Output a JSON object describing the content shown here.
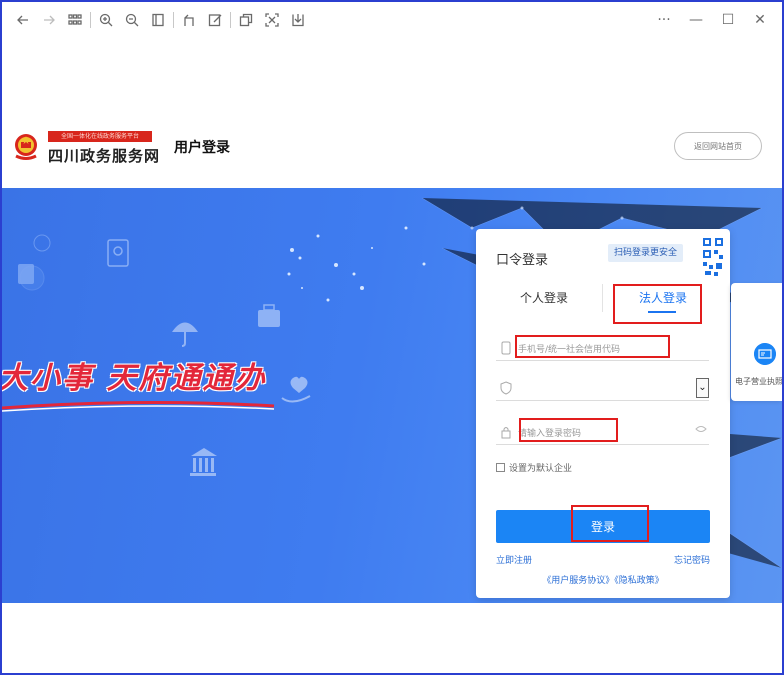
{
  "toolbar": {
    "left_icons": [
      "back-arrow-icon",
      "forward-arrow-icon",
      "grid-icon",
      "zoom-in-icon",
      "zoom-out-icon",
      "fit-page-icon",
      "rotate-icon",
      "edit-icon",
      "copy-icon",
      "crop-icon",
      "download-icon"
    ],
    "right_icons": [
      "more-icon",
      "minimize-icon",
      "maximize-icon",
      "close-icon"
    ],
    "more_glyph": "···",
    "minimize_glyph": "—",
    "maximize_glyph": "☐",
    "close_glyph": "✕"
  },
  "header": {
    "logo_tagline": "全国一体化在线政务服务平台",
    "logo_name": "四川政务服务网",
    "page_title": "用户登录",
    "home_button": "返回网站首页"
  },
  "banner": {
    "slogan": "大小事 天府通通办"
  },
  "login": {
    "title": "口令登录",
    "qr_tip": "扫码登录更安全",
    "tabs": [
      {
        "label": "个人登录",
        "active": false
      },
      {
        "label": "法人登录",
        "active": true
      }
    ],
    "account_placeholder": "手机号/统一社会信用代码",
    "select_arrow": "⌄",
    "password_placeholder": "请输入登录密码",
    "remember_label": "设置为默认企业",
    "submit_label": "登录",
    "register_link": "立即注册",
    "forgot_link": "忘记密码",
    "agreements": "《用户服务协议》《隐私政策》"
  },
  "side_panel": {
    "label": "电子营业执照"
  },
  "colors": {
    "primary": "#1b85f5",
    "banner": "#3f7cf0",
    "annotation": "#e21d1d",
    "frame": "#2b3fd0"
  }
}
